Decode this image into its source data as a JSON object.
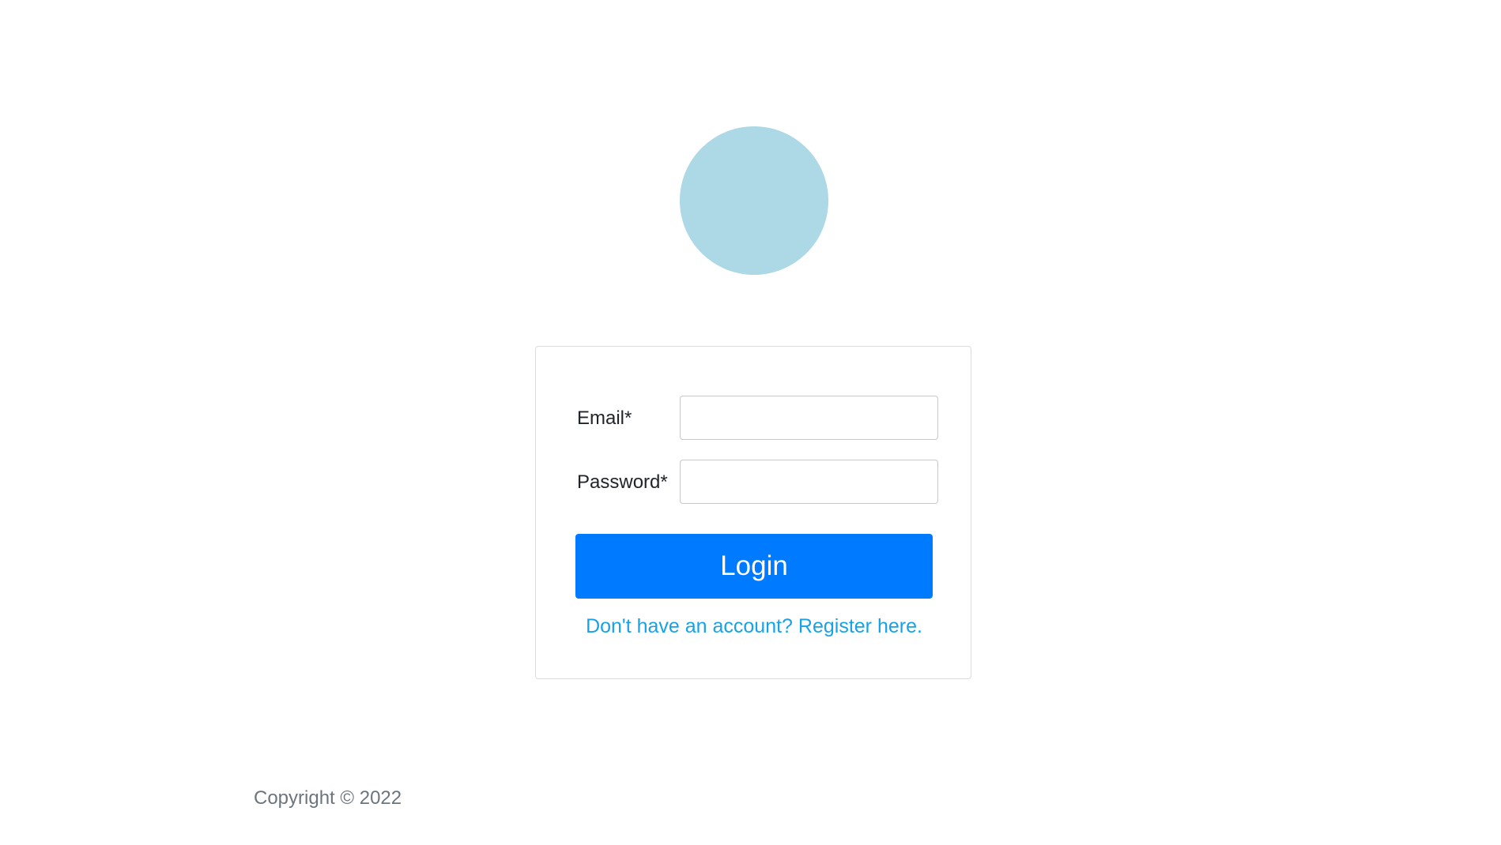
{
  "logo": {
    "color": "#add8e6",
    "icon": "logo-circle"
  },
  "login_form": {
    "email_label": "Email*",
    "email_value": "",
    "email_placeholder": "",
    "password_label": "Password*",
    "password_value": "",
    "password_placeholder": "",
    "submit_label": "Login",
    "register_link": "Don't have an account? Register here."
  },
  "footer": {
    "copyright": "Copyright © 2022"
  },
  "colors": {
    "accent": "#007bff",
    "link": "#17a2e8",
    "muted_text": "#6c757d"
  }
}
